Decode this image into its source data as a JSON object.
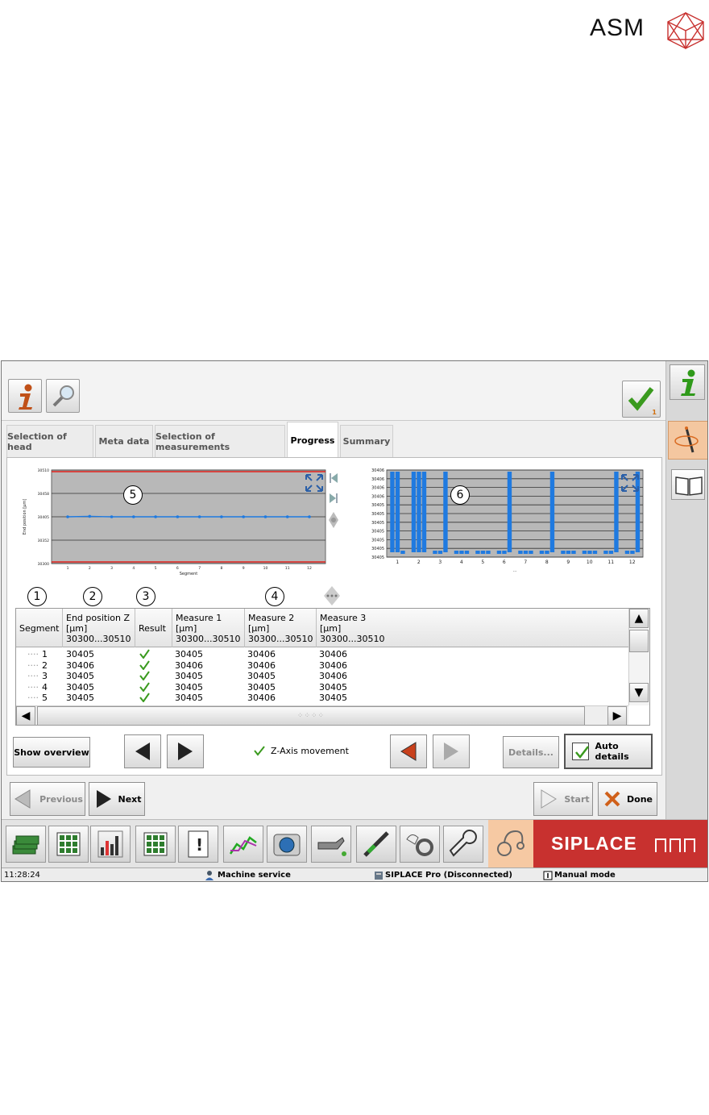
{
  "logo": {
    "text": "ASM"
  },
  "tabs": [
    {
      "label": "Selection of head",
      "active": false
    },
    {
      "label": "Meta data",
      "active": false
    },
    {
      "label": "Selection of measurements",
      "active": false
    },
    {
      "label": "Progress",
      "active": true
    },
    {
      "label": "Summary",
      "active": false
    }
  ],
  "callouts": [
    "1",
    "2",
    "3",
    "4",
    "5",
    "6"
  ],
  "chart_data": [
    {
      "type": "line",
      "x": [
        1,
        2,
        3,
        4,
        5,
        6,
        7,
        8,
        9,
        10,
        11,
        12
      ],
      "y": [
        30405,
        30406,
        30405,
        30405,
        30405,
        30405,
        30405,
        30405,
        30405,
        30405,
        30405,
        30405
      ],
      "ylim": [
        30300,
        30510
      ],
      "yticks": [
        "30510",
        "30458",
        "30405",
        "30352",
        "30300"
      ],
      "ylabel": "End position [µm]",
      "xlabel": "Segment",
      "limits": [
        30300,
        30510
      ]
    },
    {
      "type": "bar",
      "categories": [
        "1",
        "2",
        "3",
        "4",
        "5",
        "6",
        "7",
        "8",
        "9",
        "10",
        "11",
        "12"
      ],
      "series": [
        {
          "values": [
            30406,
            30406,
            30405,
            30405,
            30405,
            30405,
            30405,
            30405,
            30405,
            30405,
            30405,
            30405
          ]
        },
        {
          "values": [
            30406,
            30406,
            30405,
            30405,
            30405,
            30405,
            30405,
            30405,
            30405,
            30405,
            30405,
            30405
          ]
        },
        {
          "values": [
            30405,
            30406,
            30406,
            30405,
            30405,
            30406,
            30405,
            30406,
            30405,
            30405,
            30406,
            30406
          ]
        }
      ],
      "yticks": [
        "30406",
        "30406",
        "30406",
        "30406",
        "30405",
        "30405",
        "30405",
        "30405",
        "30405",
        "30405",
        "30405"
      ],
      "ylabel": "",
      "xlabel": "..."
    }
  ],
  "table": {
    "headers": [
      {
        "l1": "Segment",
        "l2": "",
        "l3": ""
      },
      {
        "l1": "End position Z",
        "l2": "[µm]",
        "l3": "30300...30510"
      },
      {
        "l1": "Result",
        "l2": "",
        "l3": ""
      },
      {
        "l1": "Measure 1",
        "l2": "[µm]",
        "l3": "30300...30510"
      },
      {
        "l1": "Measure 2",
        "l2": "[µm]",
        "l3": "30300...30510"
      },
      {
        "l1": "Measure 3",
        "l2": "[µm]",
        "l3": "30300...30510"
      }
    ],
    "rows": [
      {
        "seg": "1",
        "endz": "30405",
        "m1": "30405",
        "m2": "30406",
        "m3": "30406"
      },
      {
        "seg": "2",
        "endz": "30406",
        "m1": "30406",
        "m2": "30406",
        "m3": "30406"
      },
      {
        "seg": "3",
        "endz": "30405",
        "m1": "30405",
        "m2": "30405",
        "m3": "30406"
      },
      {
        "seg": "4",
        "endz": "30405",
        "m1": "30405",
        "m2": "30405",
        "m3": "30405"
      },
      {
        "seg": "5",
        "endz": "30405",
        "m1": "30405",
        "m2": "30406",
        "m3": "30405"
      }
    ]
  },
  "buttons": {
    "show_overview": "Show overview",
    "z_axis": "Z-Axis movement",
    "details": "Details...",
    "auto_details": "Auto details",
    "previous": "Previous",
    "next": "Next",
    "start": "Start",
    "done": "Done"
  },
  "badge": "1",
  "taskbar_icons": [
    "money-icon",
    "grid-icon",
    "bar-chart-icon",
    "board-icon",
    "warning-doc-icon",
    "trend-icon",
    "camera-icon",
    "oil-can-icon",
    "nozzle-icon",
    "hand-gear-icon",
    "wrench-icon"
  ],
  "siplace_label": "SIPLACE",
  "status": {
    "time": "11:28:24",
    "service": "Machine service",
    "connection": "SIPLACE Pro (Disconnected)",
    "mode": "Manual mode"
  },
  "colors": {
    "accent": "#1f7ae0",
    "limit": "#e0201a",
    "brand": "#c8312f",
    "ok": "#3a9a1e"
  }
}
